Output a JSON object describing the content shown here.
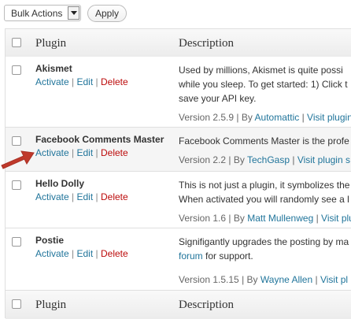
{
  "bulk": {
    "select_value": "Bulk Actions",
    "apply_label": "Apply"
  },
  "table": {
    "header": {
      "plugin": "Plugin",
      "description": "Description"
    },
    "footer": {
      "plugin": "Plugin",
      "description": "Description"
    }
  },
  "plugins": [
    {
      "name": "Akismet",
      "activate": "Activate",
      "edit": "Edit",
      "delete": "Delete",
      "desc_line1": "Used by millions, Akismet is quite possi",
      "desc_line2": "while you sleep. To get started: 1) Click t",
      "desc_line3": "save your API key.",
      "version": "Version 2.5.9",
      "by": "By",
      "author": "Automattic",
      "visit": "Visit plugin"
    },
    {
      "name": "Facebook Comments Master",
      "activate": "Activate",
      "edit": "Edit",
      "delete": "Delete",
      "desc_line1": "Facebook Comments Master is the profe",
      "version": "Version 2.2",
      "by": "By",
      "author": "TechGasp",
      "visit": "Visit plugin s"
    },
    {
      "name": "Hello Dolly",
      "activate": "Activate",
      "edit": "Edit",
      "delete": "Delete",
      "desc_line1": "This is not just a plugin, it symbolizes the",
      "desc_line2": "When activated you will randomly see a l",
      "version": "Version 1.6",
      "by": "By",
      "author": "Matt Mullenweg",
      "visit": "Visit plu"
    },
    {
      "name": "Postie",
      "activate": "Activate",
      "edit": "Edit",
      "delete": "Delete",
      "desc_line1": "Signifigantly upgrades the posting by ma",
      "desc_line2_link": "forum",
      "desc_line2_rest": " for support.",
      "version": "Version 1.5.15",
      "by": "By",
      "author": "Wayne Allen",
      "visit": "Visit pl"
    }
  ],
  "colors": {
    "link": "#21759b",
    "delete": "#bc0b0b",
    "annotation_arrow": "#c0392b"
  },
  "icons": {
    "dropdown": "chevron-down-icon",
    "annotation": "red-arrow-icon"
  }
}
